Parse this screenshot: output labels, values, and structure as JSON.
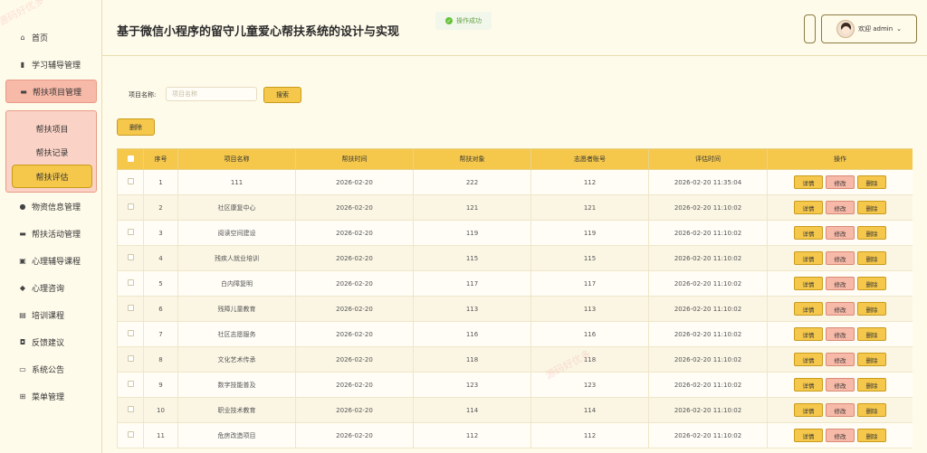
{
  "header": {
    "title": "基于微信小程序的留守儿童爱心帮扶系统的设计与实现",
    "toast": "操作成功",
    "user_greeting": "欢迎 admin"
  },
  "sidebar": {
    "items": [
      {
        "label": "首页",
        "icon": "home-icon"
      },
      {
        "label": "学习辅导管理",
        "icon": "bar-chart-icon"
      },
      {
        "label": "帮扶项目管理",
        "icon": "folder-icon"
      },
      {
        "label": "物资信息管理",
        "icon": "circle-icon"
      },
      {
        "label": "帮扶活动管理",
        "icon": "card-icon"
      },
      {
        "label": "心理辅导课程",
        "icon": "copy-icon"
      },
      {
        "label": "心理咨询",
        "icon": "shield-icon"
      },
      {
        "label": "培训课程",
        "icon": "monitor-icon"
      },
      {
        "label": "反馈建议",
        "icon": "message-icon"
      },
      {
        "label": "系统公告",
        "icon": "notice-icon"
      },
      {
        "label": "菜单管理",
        "icon": "grid-icon"
      }
    ],
    "submenu": [
      {
        "label": "帮扶项目"
      },
      {
        "label": "帮扶记录"
      },
      {
        "label": "帮扶评估"
      }
    ]
  },
  "search": {
    "label": "项目名称:",
    "placeholder": "项目名称",
    "button": "搜索"
  },
  "toolbar": {
    "delete_label": "删除"
  },
  "table": {
    "columns": [
      "序号",
      "项目名称",
      "帮扶时间",
      "帮扶对象",
      "志愿者账号",
      "评估时间",
      "操作"
    ],
    "actions": {
      "detail": "详情",
      "edit": "修改",
      "delete": "删除"
    },
    "rows": [
      {
        "no": "1",
        "name": "111",
        "date": "2026-02-20",
        "target": "222",
        "account": "112",
        "eval": "2026-02-20 11:35:04"
      },
      {
        "no": "2",
        "name": "社区康复中心",
        "date": "2026-02-20",
        "target": "121",
        "account": "121",
        "eval": "2026-02-20 11:10:02"
      },
      {
        "no": "3",
        "name": "阅读空间建设",
        "date": "2026-02-20",
        "target": "119",
        "account": "119",
        "eval": "2026-02-20 11:10:02"
      },
      {
        "no": "4",
        "name": "残疾人就业培训",
        "date": "2026-02-20",
        "target": "115",
        "account": "115",
        "eval": "2026-02-20 11:10:02"
      },
      {
        "no": "5",
        "name": "白内障复明",
        "date": "2026-02-20",
        "target": "117",
        "account": "117",
        "eval": "2026-02-20 11:10:02"
      },
      {
        "no": "6",
        "name": "残障儿童教育",
        "date": "2026-02-20",
        "target": "113",
        "account": "113",
        "eval": "2026-02-20 11:10:02"
      },
      {
        "no": "7",
        "name": "社区志愿服务",
        "date": "2026-02-20",
        "target": "116",
        "account": "116",
        "eval": "2026-02-20 11:10:02"
      },
      {
        "no": "8",
        "name": "文化艺术传承",
        "date": "2026-02-20",
        "target": "118",
        "account": "118",
        "eval": "2026-02-20 11:10:02"
      },
      {
        "no": "9",
        "name": "数字技能普及",
        "date": "2026-02-20",
        "target": "123",
        "account": "123",
        "eval": "2026-02-20 11:10:02"
      },
      {
        "no": "10",
        "name": "职业技术教育",
        "date": "2026-02-20",
        "target": "114",
        "account": "114",
        "eval": "2026-02-20 11:10:02"
      },
      {
        "no": "11",
        "name": "危房改造项目",
        "date": "2026-02-20",
        "target": "112",
        "account": "112",
        "eval": "2026-02-20 11:10:02"
      }
    ]
  },
  "colors": {
    "accent": "#f5c84c",
    "active_menu": "#f7b9a8",
    "background": "#fffbeb"
  }
}
